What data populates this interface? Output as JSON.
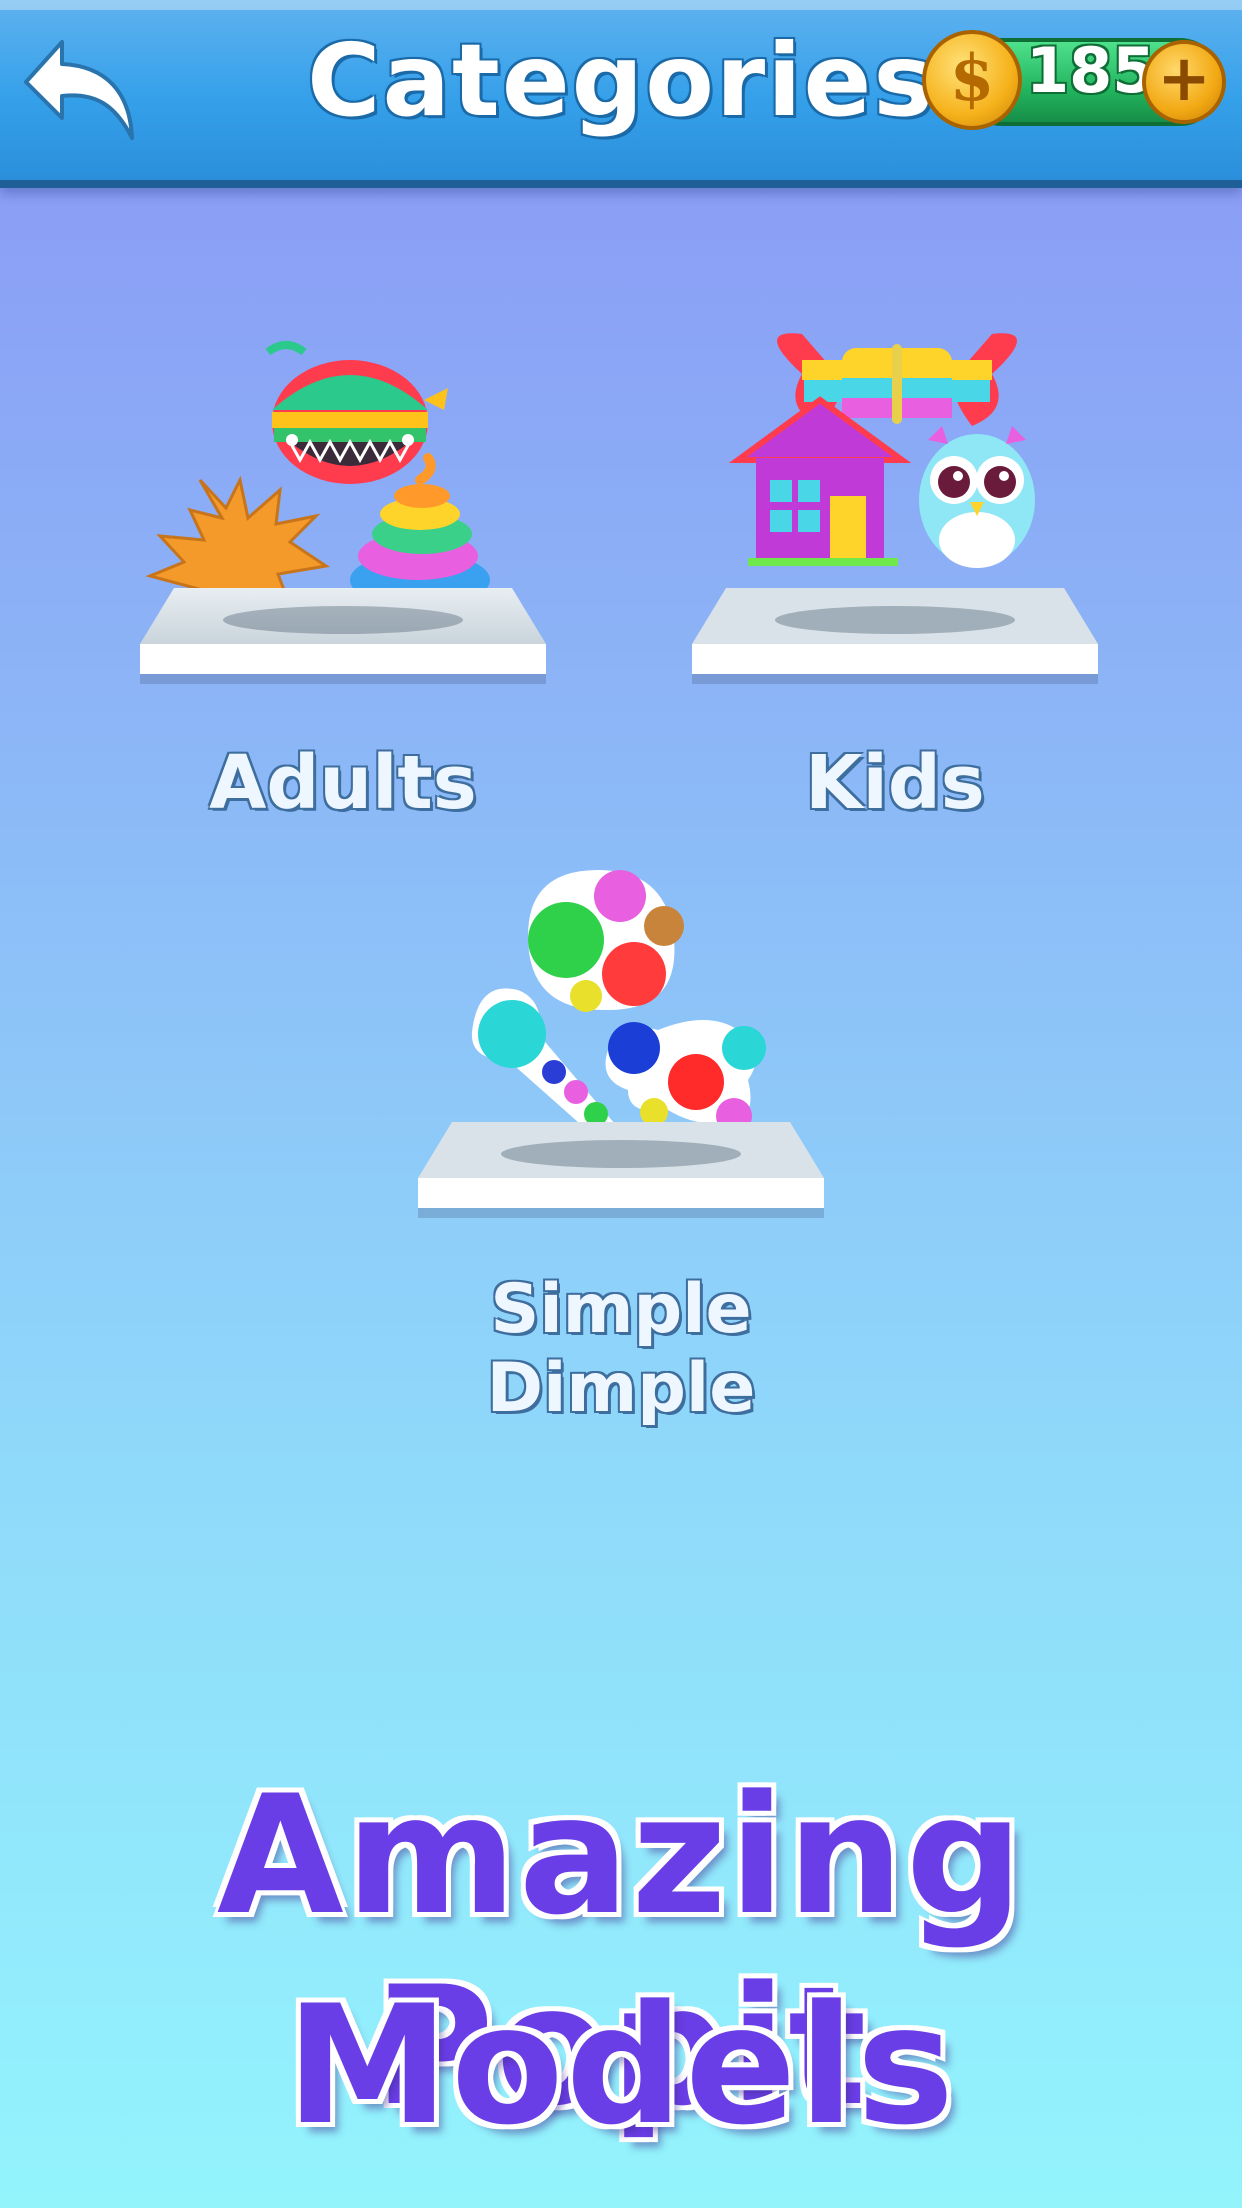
{
  "header": {
    "title": "Categories",
    "coins": "185",
    "coin_symbol": "$",
    "plus_symbol": "+",
    "back_icon": "back-arrow-icon"
  },
  "categories": [
    {
      "label": "Adults",
      "models": [
        "whale-popit-icon",
        "maple-leaf-popit-icon",
        "swirl-popit-icon"
      ]
    },
    {
      "label": "Kids",
      "models": [
        "butterfly-popit-icon",
        "house-popit-icon",
        "owl-popit-icon"
      ]
    },
    {
      "label": "Simple Dimple",
      "models": [
        "simple-dimple-flower-icon",
        "simple-dimple-stick-icon",
        "simple-dimple-star-icon"
      ]
    }
  ],
  "promo": {
    "line1": "Amazing Popit",
    "line2": "Models"
  },
  "colors": {
    "accent": "#6a3ee6",
    "header": "#35a0ea",
    "coin_pill": "#22b45e",
    "coin": "#f6b21b"
  }
}
